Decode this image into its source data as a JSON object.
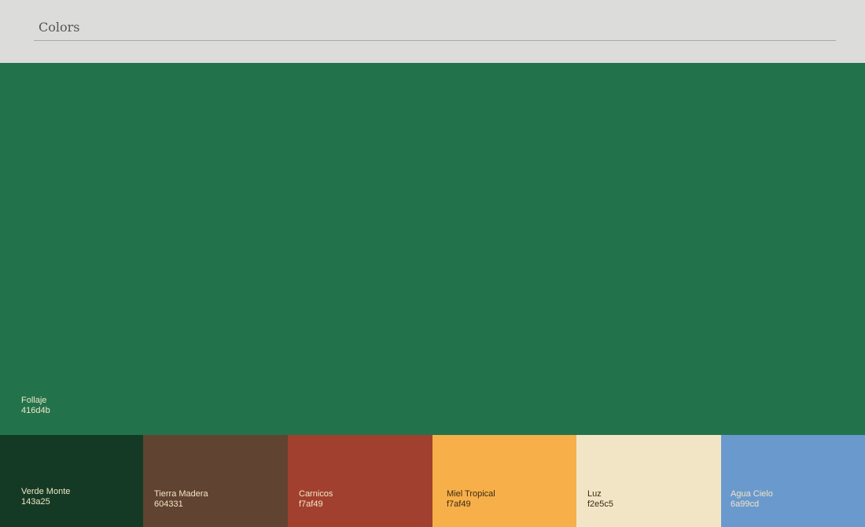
{
  "header": {
    "title": "Colors"
  },
  "main_swatch": {
    "name": "Follaje",
    "code": "416d4b",
    "color": "#22734c",
    "text_color": "#f2e5c5"
  },
  "swatches": [
    {
      "name": "Verde Monte",
      "code": "143a25",
      "color": "#143a25",
      "text_color": "#f2e5c5"
    },
    {
      "name": "Tierra Madera",
      "code": "604331",
      "color": "#604331",
      "text_color": "#f2e5c5"
    },
    {
      "name": "Carnicos",
      "code": "f7af49",
      "color": "#a24030",
      "text_color": "#f2e5c5"
    },
    {
      "name": "Miel Tropical",
      "code": "f7af49",
      "color": "#f7af49",
      "text_color": "#3a2a14"
    },
    {
      "name": "Luz",
      "code": "f2e5c5",
      "color": "#f2e5c5",
      "text_color": "#3a2a14"
    },
    {
      "name": "Agua Cielo",
      "code": "6a99cd",
      "color": "#6a99cd",
      "text_color": "#f2e5c5"
    }
  ]
}
